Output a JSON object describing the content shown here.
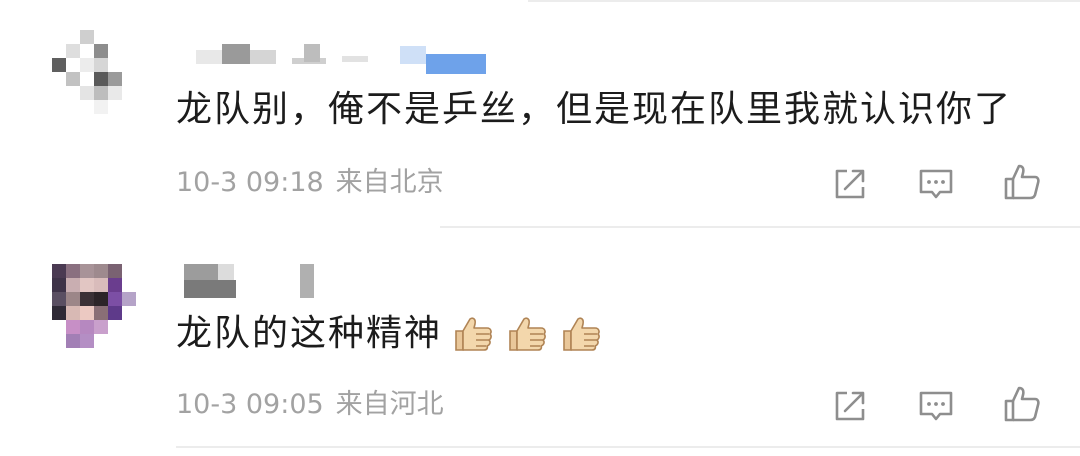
{
  "comments": [
    {
      "avatar_colors": [
        "#ffffff",
        "#ffffff",
        "#cfcfcf",
        "#ffffff",
        "#ffffff",
        "#ffffff",
        "#ffffff",
        "#dedede",
        "#ffffff",
        "#8d8d8d",
        "#ffffff",
        "#ffffff",
        "#5f5f5f",
        "#ffffff",
        "#ececec",
        "#d6d6d6",
        "#ffffff",
        "#ffffff",
        "#ffffff",
        "#c2c2c2",
        "#ffffff",
        "#5a5a5a",
        "#9a9a9a",
        "#ffffff",
        "#ffffff",
        "#ffffff",
        "#e4e4e4",
        "#bdbdbd",
        "#e9e9e9",
        "#ffffff",
        "#ffffff",
        "#ffffff",
        "#ffffff",
        "#f2f2f2",
        "#ffffff",
        "#ffffff"
      ],
      "text": "龙队别，俺不是乒丝，但是现在队里我就认识你了",
      "time": "10-3 09:18",
      "location": "来自北京"
    },
    {
      "avatar_colors": [
        "#4a3a52",
        "#8a7080",
        "#a89398",
        "#9e8a8e",
        "#7a6272",
        "#ffffff",
        "#3e3348",
        "#c9aeb1",
        "#e2c6c3",
        "#d9bcbb",
        "#6a3d8e",
        "#ffffff",
        "#5a4f62",
        "#9c8688",
        "#3b3136",
        "#2c2428",
        "#7c4fa5",
        "#b5a3c8",
        "#2f2a36",
        "#d8b9b4",
        "#ecc9c2",
        "#8a6f76",
        "#5e3a8a",
        "#ffffff",
        "#ffffff",
        "#c78fc6",
        "#b688c0",
        "#c9a0cc",
        "#ffffff",
        "#ffffff",
        "#ffffff",
        "#a27fb5",
        "#b48ec4",
        "#ffffff",
        "#ffffff",
        "#ffffff"
      ],
      "text": "龙队的这种精神",
      "emoji": [
        "thumbs-up",
        "thumbs-up",
        "thumbs-up"
      ],
      "time": "10-3 09:05",
      "location": "来自河北"
    }
  ],
  "actions": [
    {
      "name": "share-icon"
    },
    {
      "name": "comment-icon"
    },
    {
      "name": "like-icon"
    }
  ],
  "colors": {
    "text": "#1c1c1c",
    "meta": "#a2a2a2",
    "icon": "#8e8e8e",
    "divider": "#ececec"
  }
}
